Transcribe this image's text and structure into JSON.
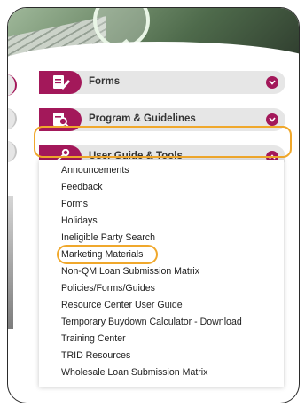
{
  "accordion": {
    "sections": [
      {
        "label": "Forms",
        "icon": "document-pen-icon",
        "state": "collapsed"
      },
      {
        "label": "Program & Guidelines",
        "icon": "document-search-icon",
        "state": "collapsed"
      },
      {
        "label": "User Guide & Tools",
        "icon": "key-icon",
        "state": "expanded"
      }
    ],
    "items": [
      "Announcements",
      "Feedback",
      "Forms",
      "Holidays",
      "Ineligible Party Search",
      "Marketing Materials",
      "Non-QM Loan Submission Matrix",
      "Policies/Forms/Guides",
      "Resource Center User Guide",
      "Temporary Buydown Calculator - Download",
      "Training Center",
      "TRID Resources",
      "Wholesale Loan Submission Matrix"
    ],
    "highlighted_item": "Marketing Materials"
  },
  "colors": {
    "accent": "#a3185a",
    "highlight": "#f0a82c",
    "header_bg": "#e6e6e6"
  }
}
